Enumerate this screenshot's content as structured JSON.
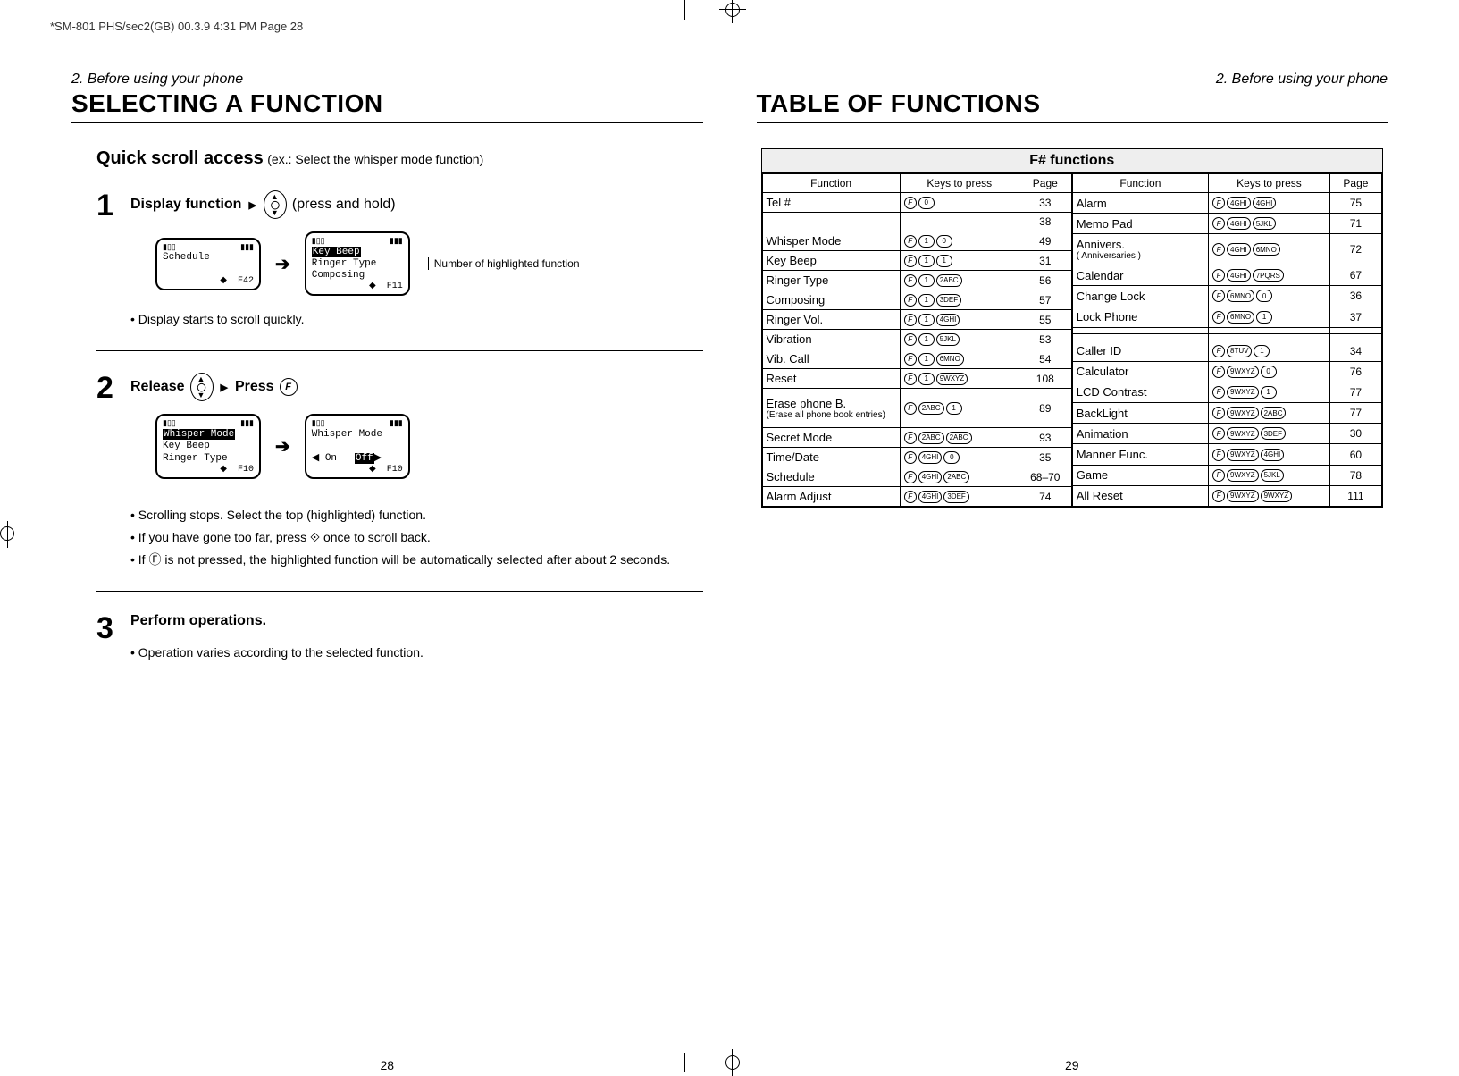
{
  "print_header": "*SM-801 PHS/sec2(GB)  00.3.9 4:31 PM  Page 28",
  "left_page": {
    "breadcrumb": "2. Before using your phone",
    "title": "SELECTING A FUNCTION",
    "page_num": "28",
    "qsa_title": "Quick scroll access",
    "qsa_example": "(ex.: Select the whisper mode function)",
    "step1": {
      "num": "1",
      "title": "Display function",
      "tri": "▶",
      "hint": "(press and hold)",
      "lcd_a": {
        "l1": "Schedule",
        "ft": "F42"
      },
      "lcd_b": {
        "hl": "Key Beep",
        "l2": "Ringer Type",
        "l3": "Composing",
        "ft": "F11"
      },
      "annot": "Number of highlighted function",
      "bullet": "Display starts to scroll quickly."
    },
    "step2": {
      "num": "2",
      "release": "Release",
      "press": "Press",
      "lcd_a": {
        "hl": "Whisper Mode",
        "l2": "Key Beep",
        "l3": "Ringer Type",
        "ft": "F10"
      },
      "lcd_b": {
        "l1": "Whisper Mode",
        "on": "On",
        "off": "Off",
        "ft": "F10"
      },
      "bullets": [
        "Scrolling stops. Select the top (highlighted) function.",
        "If you have gone too far, press  ⟐  once to scroll back.",
        "If Ⓕ is not pressed, the highlighted function will be automatically selected after about 2 seconds."
      ]
    },
    "step3": {
      "num": "3",
      "title": "Perform operations.",
      "bullet": "Operation varies according to the selected function."
    }
  },
  "right_page": {
    "breadcrumb": "2. Before using your phone",
    "title": "TABLE OF FUNCTIONS",
    "page_num": "29",
    "table_title": "F# functions",
    "headers": {
      "func": "Function",
      "keys": "Keys to press",
      "page": "Page"
    },
    "left_col": [
      {
        "name": "Tel #",
        "keys": [
          "F",
          "0"
        ],
        "page": "33"
      },
      {
        "name": "",
        "keys": [],
        "page": "38"
      },
      {
        "name": "Whisper Mode",
        "keys": [
          "F",
          "1",
          "0"
        ],
        "page": "49"
      },
      {
        "name": "Key Beep",
        "keys": [
          "F",
          "1",
          "1"
        ],
        "page": "31"
      },
      {
        "name": "Ringer Type",
        "keys": [
          "F",
          "1",
          "2ABC"
        ],
        "page": "56"
      },
      {
        "name": "Composing",
        "keys": [
          "F",
          "1",
          "3DEF"
        ],
        "page": "57"
      },
      {
        "name": "Ringer Vol.",
        "keys": [
          "F",
          "1",
          "4GHI"
        ],
        "page": "55"
      },
      {
        "name": "Vibration",
        "keys": [
          "F",
          "1",
          "5JKL"
        ],
        "page": "53"
      },
      {
        "name": "Vib. Call",
        "keys": [
          "F",
          "1",
          "6MNO"
        ],
        "page": "54"
      },
      {
        "name": "Reset",
        "keys": [
          "F",
          "1",
          "9WXYZ"
        ],
        "page": "108"
      },
      {
        "name": "Erase phone B.",
        "sub": "(Erase all phone book entries)",
        "keys": [
          "F",
          "2ABC",
          "1"
        ],
        "page": "89",
        "tall": true
      },
      {
        "name": "Secret Mode",
        "keys": [
          "F",
          "2ABC",
          "2ABC"
        ],
        "page": "93"
      },
      {
        "name": "Time/Date",
        "keys": [
          "F",
          "4GHI",
          "0"
        ],
        "page": "35"
      },
      {
        "name": "Schedule",
        "keys": [
          "F",
          "4GHI",
          "2ABC"
        ],
        "page": "68–70"
      },
      {
        "name": "Alarm Adjust",
        "keys": [
          "F",
          "4GHI",
          "3DEF"
        ],
        "page": "74"
      }
    ],
    "right_col": [
      {
        "name": "Alarm",
        "keys": [
          "F",
          "4GHI",
          "4GHI"
        ],
        "page": "75"
      },
      {
        "name": "Memo Pad",
        "keys": [
          "F",
          "4GHI",
          "5JKL"
        ],
        "page": "71"
      },
      {
        "name": "Annivers.",
        "sub": "( Anniversaries  )",
        "keys": [
          "F",
          "4GHI",
          "6MNO"
        ],
        "page": "72"
      },
      {
        "name": "Calendar",
        "keys": [
          "F",
          "4GHI",
          "7PQRS"
        ],
        "page": "67"
      },
      {
        "name": "Change Lock",
        "keys": [
          "F",
          "6MNO",
          "0"
        ],
        "page": "36"
      },
      {
        "name": "Lock Phone",
        "keys": [
          "F",
          "6MNO",
          "1"
        ],
        "page": "37"
      },
      {
        "name": "",
        "keys": [],
        "page": ""
      },
      {
        "name": "",
        "keys": [],
        "page": ""
      },
      {
        "name": "Caller ID",
        "keys": [
          "F",
          "8TUV",
          "1"
        ],
        "page": "34"
      },
      {
        "name": "Calculator",
        "keys": [
          "F",
          "9WXYZ",
          "0"
        ],
        "page": "76"
      },
      {
        "name": "LCD Contrast",
        "keys": [
          "F",
          "9WXYZ",
          "1"
        ],
        "page": "77"
      },
      {
        "name": "BackLight",
        "keys": [
          "F",
          "9WXYZ",
          "2ABC"
        ],
        "page": "77"
      },
      {
        "name": "Animation",
        "keys": [
          "F",
          "9WXYZ",
          "3DEF"
        ],
        "page": "30"
      },
      {
        "name": "Manner Func.",
        "keys": [
          "F",
          "9WXYZ",
          "4GHI"
        ],
        "page": "60"
      },
      {
        "name": "Game",
        "keys": [
          "F",
          "9WXYZ",
          "5JKL"
        ],
        "page": "78"
      },
      {
        "name": "All Reset",
        "keys": [
          "F",
          "9WXYZ",
          "9WXYZ"
        ],
        "page": "111"
      }
    ]
  }
}
